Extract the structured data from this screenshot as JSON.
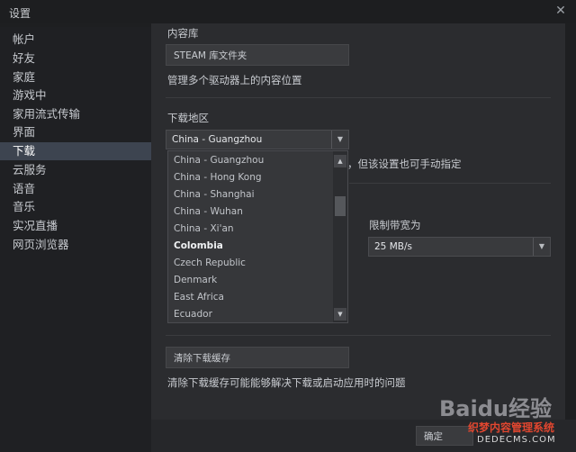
{
  "window": {
    "title": "设置",
    "close_glyph": "✕"
  },
  "sidebar": {
    "items": [
      {
        "label": "帐户"
      },
      {
        "label": "好友"
      },
      {
        "label": "家庭"
      },
      {
        "label": "游戏中"
      },
      {
        "label": "家用流式传输"
      },
      {
        "label": "界面"
      },
      {
        "label": "下载",
        "selected": true
      },
      {
        "label": "云服务"
      },
      {
        "label": "语音"
      },
      {
        "label": "音乐"
      },
      {
        "label": "实况直播"
      },
      {
        "label": "网页浏览器"
      }
    ]
  },
  "library": {
    "heading": "内容库",
    "button_label": "STEAM 库文件夹",
    "description": "管理多个驱动器上的内容位置"
  },
  "download_region": {
    "heading": "下载地区",
    "selected": "China - Guangzhou",
    "hint_partial": "，但该设置也可手动指定",
    "options": [
      {
        "label": "China - Guangzhou"
      },
      {
        "label": "China - Hong Kong"
      },
      {
        "label": "China - Shanghai"
      },
      {
        "label": "China - Wuhan"
      },
      {
        "label": "China - Xi'an"
      },
      {
        "label": "Colombia",
        "bold": true
      },
      {
        "label": "Czech Republic"
      },
      {
        "label": "Denmark"
      },
      {
        "label": "East Africa"
      },
      {
        "label": "Ecuador"
      }
    ]
  },
  "bandwidth": {
    "label": "限制带宽为",
    "value": "25 MB/s"
  },
  "cache": {
    "button_label": "清除下载缓存",
    "description": "清除下载缓存可能能够解决下载或启动应用时的问题"
  },
  "footer": {
    "ok_label": "确定"
  },
  "watermark": {
    "brand_text": "Baidu经验",
    "site_text": "织梦内容管理系统",
    "site_domain": "DEDECMS.COM"
  },
  "colors": {
    "accent_selected": "#3d4450",
    "panel": "#2b2c2f",
    "sidebar": "#1f2023"
  }
}
